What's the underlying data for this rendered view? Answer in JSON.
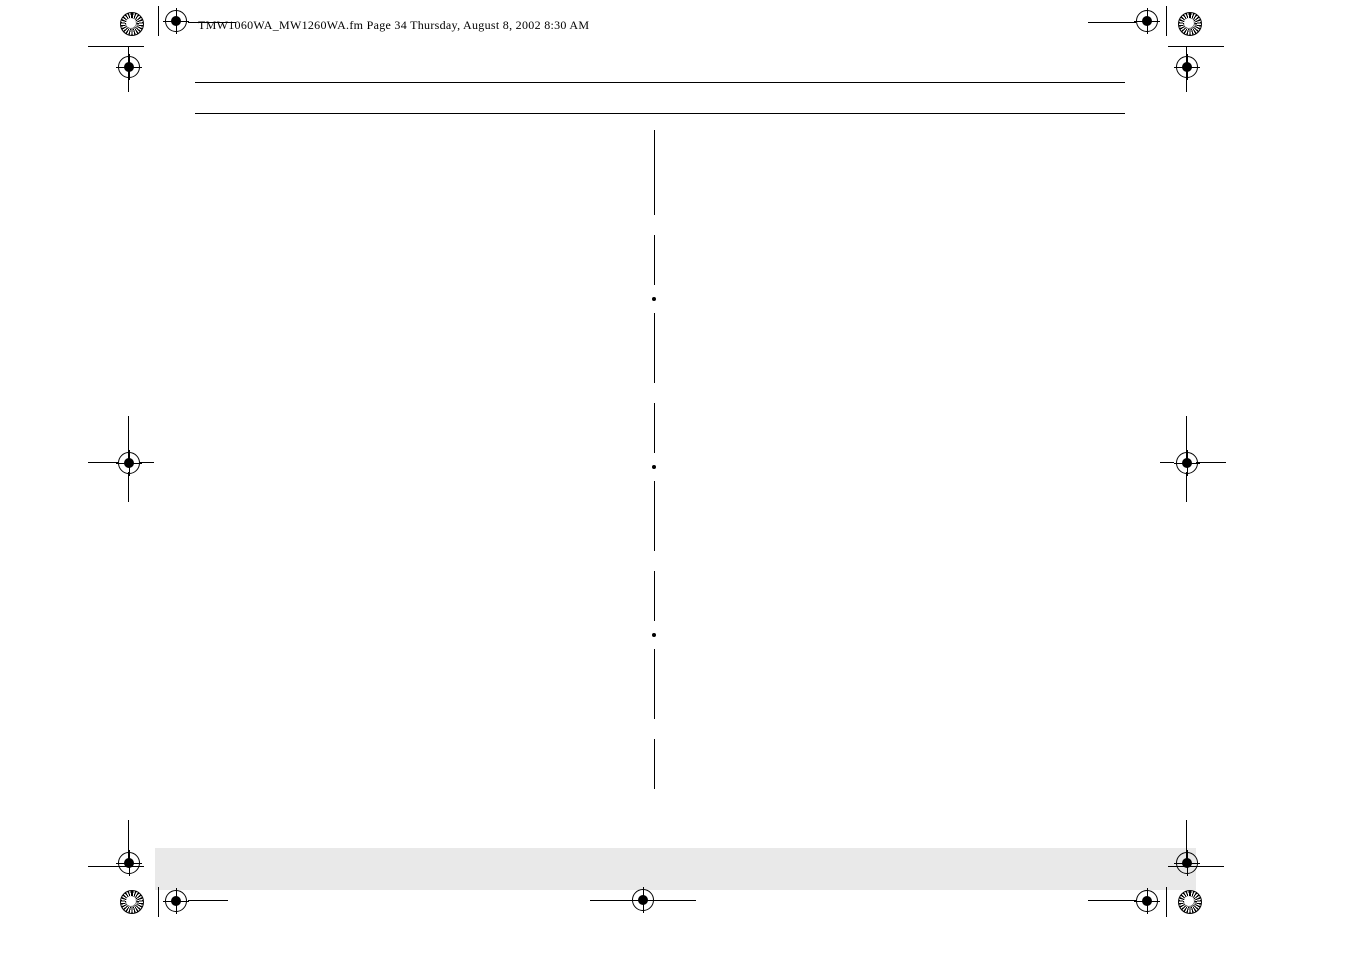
{
  "header": {
    "filename": "TMW1060WA_MW1260WA.fm",
    "page_label": "Page 34",
    "day": "Thursday,",
    "date": "August 8, 2002",
    "time": "8:30 AM"
  }
}
